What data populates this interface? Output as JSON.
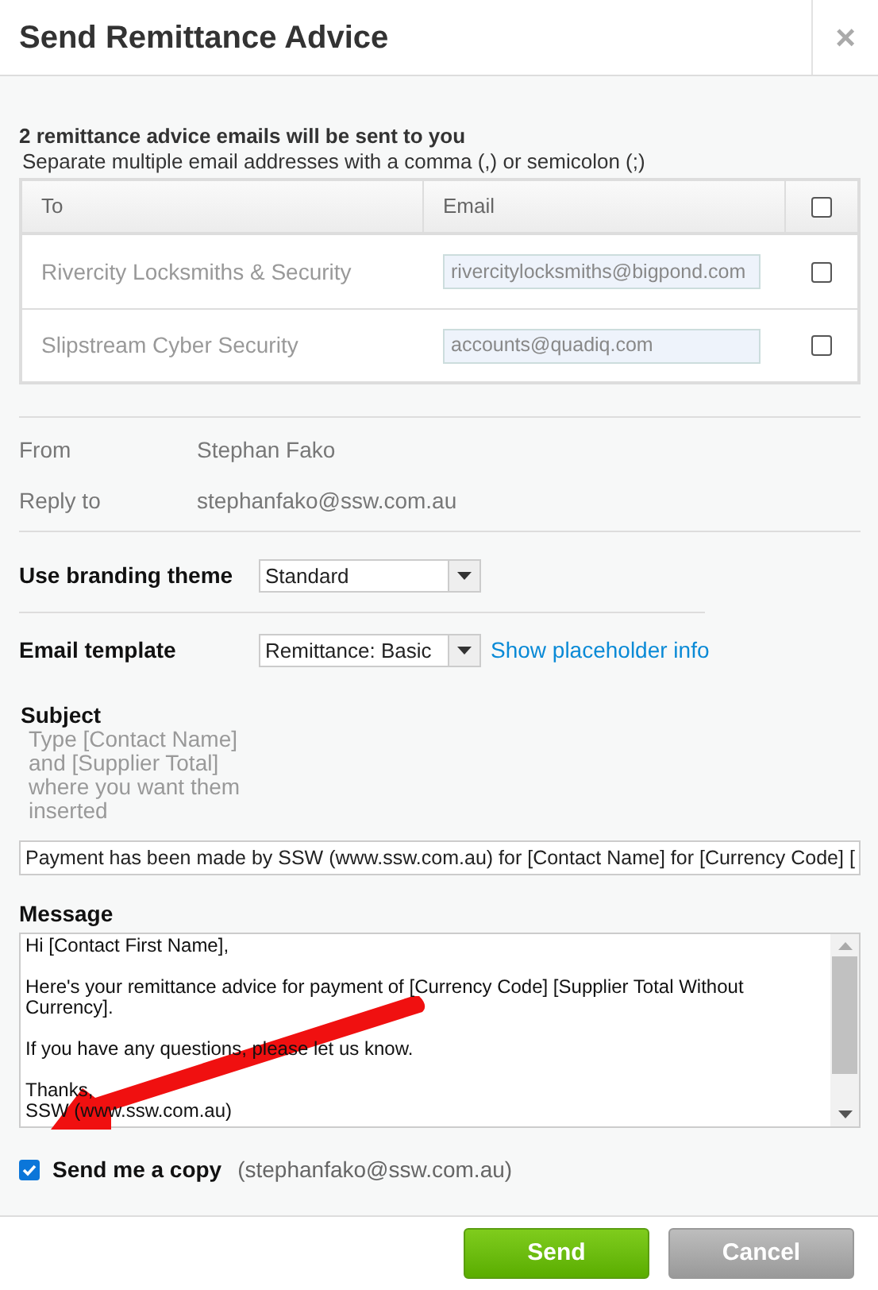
{
  "window": {
    "title": "Send Remittance Advice",
    "close": "×"
  },
  "summary": "2 remittance advice emails will be sent to you",
  "hint": "Separate multiple email addresses with a comma (,) or semicolon (;)",
  "table": {
    "columns": [
      "To",
      "Email"
    ],
    "all_checked": false,
    "rows": [
      {
        "to": "Rivercity Locksmiths & Security",
        "email": "rivercitylocksmiths@bigpond.com",
        "checked": false
      },
      {
        "to": "Slipstream Cyber Security",
        "email": "accounts@quadiq.com",
        "checked": false
      }
    ]
  },
  "from": {
    "label": "From",
    "value": "Stephan Fako"
  },
  "reply_to": {
    "label": "Reply to",
    "value": "stephanfako@ssw.com.au"
  },
  "branding": {
    "label": "Use branding theme",
    "value": "Standard"
  },
  "template": {
    "label": "Email template",
    "value": "Remittance: Basic",
    "link": "Show placeholder info"
  },
  "subject": {
    "label": "Subject",
    "help": "Type [Contact Name] and [Supplier Total] where you want them inserted",
    "value": "Payment has been made by SSW (www.ssw.com.au) for [Contact Name] for [Currency Code] ["
  },
  "message": {
    "label": "Message",
    "paragraphs": [
      [
        "Hi [Contact First Name],"
      ],
      [
        "Here's your remittance advice for payment of [Currency Code] [Supplier Total Without Currency]."
      ],
      [
        "If you have any questions, please let us know."
      ],
      [
        "Thanks,",
        "SSW (www.ssw.com.au)"
      ]
    ]
  },
  "copy": {
    "label": "Send me a copy",
    "address": "(stephanfako@ssw.com.au)",
    "checked": true
  },
  "buttons": [
    {
      "label": "Send",
      "kind": "primary"
    },
    {
      "label": "Cancel",
      "kind": "secondary"
    }
  ]
}
